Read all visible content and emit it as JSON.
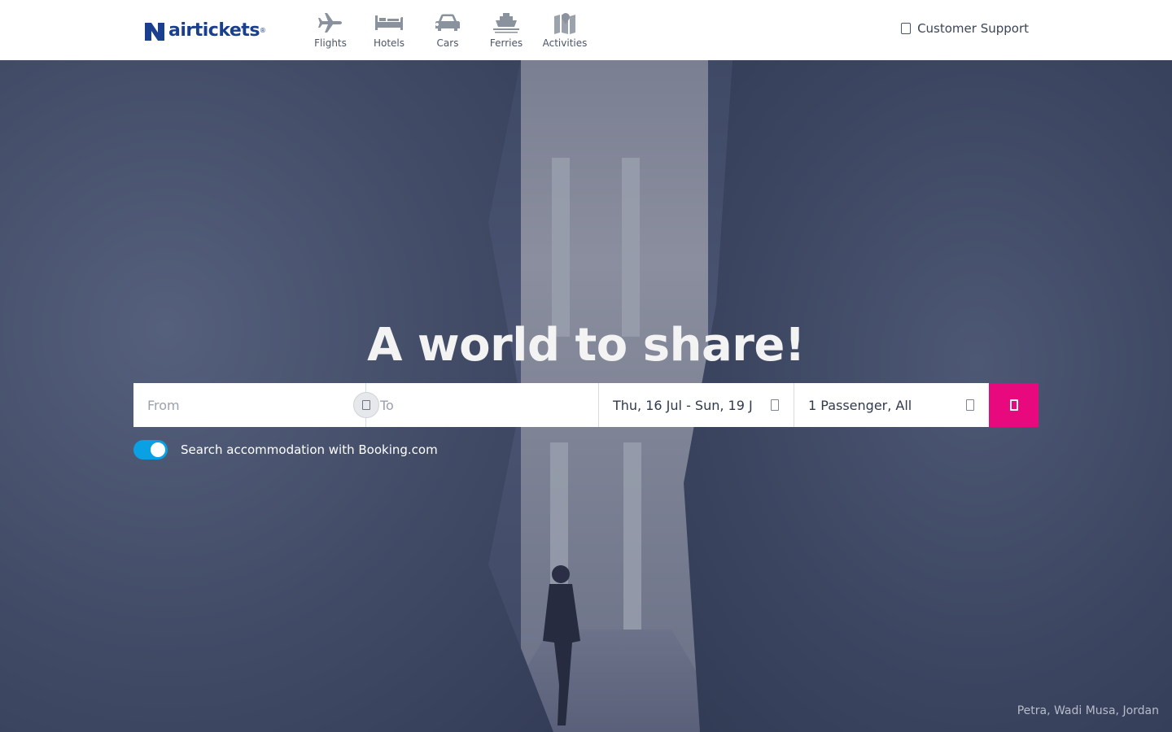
{
  "header": {
    "logo_text": "airtickets",
    "logo_reg": "®",
    "nav": [
      {
        "label": "Flights",
        "icon": "airplane-icon"
      },
      {
        "label": "Hotels",
        "icon": "bed-icon"
      },
      {
        "label": "Cars",
        "icon": "car-icon"
      },
      {
        "label": "Ferries",
        "icon": "ship-icon"
      },
      {
        "label": "Activities",
        "icon": "map-pin-icon"
      }
    ],
    "support_label": "Customer Support"
  },
  "hero": {
    "headline": "A world to share!",
    "caption": "Petra, Wadi Musa, Jordan"
  },
  "search": {
    "from_placeholder": "From",
    "to_placeholder": "To",
    "dates_value": "Thu, 16 Jul - Sun, 19 J",
    "passengers_value": "1 Passenger, All"
  },
  "booking_toggle": {
    "label": "Search accommodation with Booking.com",
    "enabled": true
  },
  "colors": {
    "brand": "#1a3f8e",
    "search_button": "#e8097e",
    "toggle_on": "#0aa1e4"
  }
}
